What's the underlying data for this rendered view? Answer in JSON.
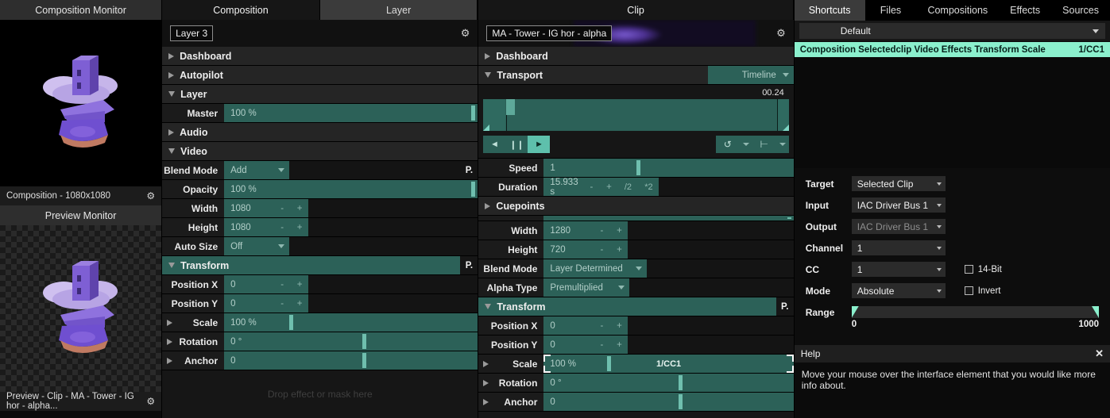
{
  "left": {
    "composition_monitor_title": "Composition Monitor",
    "composition_footer": "Composition - 1080x1080",
    "preview_monitor_title": "Preview Monitor",
    "preview_footer": "Preview - Clip - MA - Tower - IG hor - alpha...",
    "gear_icon": "gear-icon"
  },
  "composition_panel": {
    "tabs": [
      {
        "label": "Composition",
        "active": true
      },
      {
        "label": "Layer",
        "active": false
      }
    ],
    "layer_name": "Layer 3",
    "gear_icon": "gear-icon",
    "rows": {
      "dashboard": "Dashboard",
      "autopilot": "Autopilot",
      "layer": "Layer",
      "master_label": "Master",
      "master_value": "100 %",
      "audio": "Audio",
      "video": "Video",
      "blend_mode_label": "Blend Mode",
      "blend_mode_value": "Add",
      "opacity_label": "Opacity",
      "opacity_value": "100 %",
      "width_label": "Width",
      "width_value": "1080",
      "height_label": "Height",
      "height_value": "1080",
      "auto_size_label": "Auto Size",
      "auto_size_value": "Off",
      "transform": "Transform",
      "position_x_label": "Position X",
      "position_x_value": "0",
      "position_y_label": "Position Y",
      "position_y_value": "0",
      "scale_label": "Scale",
      "scale_value": "100 %",
      "rotation_label": "Rotation",
      "rotation_value": "0 °",
      "anchor_label": "Anchor",
      "anchor_value": "0",
      "minus": "-",
      "plus": "+",
      "pin": "P."
    },
    "dropzone": "Drop effect or mask here"
  },
  "clip_panel": {
    "tab_label": "Clip",
    "clip_name": "MA - Tower - IG hor - alpha",
    "gear_icon": "gear-icon",
    "rows": {
      "dashboard": "Dashboard",
      "transport": "Transport",
      "transport_mode": "Timeline",
      "timecode": "00.24",
      "prev_icon": "skip-back-icon",
      "pause_icon": "pause-icon",
      "play_icon": "play-icon",
      "loop_icon": "loop-icon",
      "cue_icon": "cue-icon",
      "speed_label": "Speed",
      "speed_value": "1",
      "duration_label": "Duration",
      "duration_value": "15.933 s",
      "duration_div": "/2",
      "duration_mul": "*2",
      "cuepoints": "Cuepoints",
      "width_label": "Width",
      "width_value": "1280",
      "height_label": "Height",
      "height_value": "720",
      "blend_mode_label": "Blend Mode",
      "blend_mode_value": "Layer Determined",
      "alpha_type_label": "Alpha Type",
      "alpha_type_value": "Premultiplied",
      "transform": "Transform",
      "position_x_label": "Position X",
      "position_x_value": "0",
      "position_y_label": "Position Y",
      "position_y_value": "0",
      "scale_label": "Scale",
      "scale_value": "100 %",
      "scale_mapping": "1/CC1",
      "rotation_label": "Rotation",
      "rotation_value": "0 °",
      "anchor_label": "Anchor",
      "anchor_value": "0",
      "minus": "-",
      "plus": "+",
      "pin": "P."
    }
  },
  "right_panel": {
    "tabs": [
      {
        "label": "Shortcuts",
        "active": true
      },
      {
        "label": "Files",
        "active": false
      },
      {
        "label": "Compositions",
        "active": false
      },
      {
        "label": "Effects",
        "active": false
      },
      {
        "label": "Sources",
        "active": false
      }
    ],
    "preset": "Default",
    "shortcuts": [
      {
        "path": "Composition Selectedclip Video Effects Transform Scale",
        "key": "1/CC1"
      }
    ],
    "mapping": {
      "target_label": "Target",
      "target_value": "Selected Clip",
      "input_label": "Input",
      "input_value": "IAC Driver Bus 1",
      "output_label": "Output",
      "output_value": "IAC Driver Bus 1",
      "channel_label": "Channel",
      "channel_value": "1",
      "cc_label": "CC",
      "cc_value": "1",
      "bit14_label": "14-Bit",
      "mode_label": "Mode",
      "mode_value": "Absolute",
      "invert_label": "Invert",
      "range_label": "Range",
      "range_min": "0",
      "range_max": "1000"
    },
    "help": {
      "title": "Help",
      "close_icon": "close-icon",
      "body": "Move your mouse over the interface element that you would like more info about."
    }
  },
  "colors": {
    "teal": "#2c6158",
    "mint": "#8bf0cd",
    "panel_bg": "#161616"
  }
}
